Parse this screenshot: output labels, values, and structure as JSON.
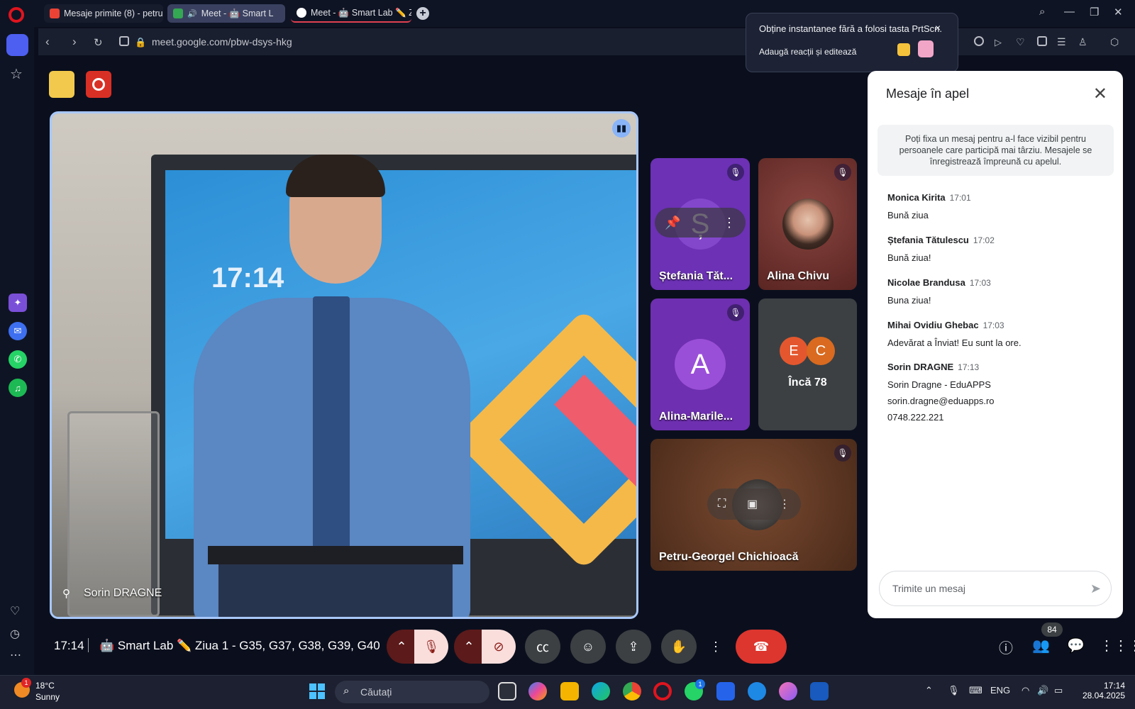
{
  "browser": {
    "tabs": [
      {
        "label": "Mesaje primite (8) - petru",
        "color": "#ea4335"
      },
      {
        "label": "Meet - 🤖 Smart L"
      },
      {
        "label": "Meet - 🤖 Smart Lab ✏️ Z"
      }
    ],
    "url": "meet.google.com/pbw-dsys-hkg"
  },
  "toast": {
    "line1": "Obține instantanee fără a folosi tasta PrtScn.",
    "line2": "Adaugă reacții și editează",
    "close": "×"
  },
  "main_tile": {
    "name": "Sorin DRAGNE",
    "screen_clock": "17:14"
  },
  "participants": [
    {
      "name": "Ștefania Tăt...",
      "initial": "Ș",
      "color": "#6c31b5"
    },
    {
      "name": "Alina Chivu",
      "color": "#6b2a26"
    },
    {
      "name": "Alina-Marile...",
      "initial": "A",
      "color": "#6e2fb0"
    },
    {
      "more_label": "Încă 78",
      "avatars": [
        {
          "letter": "E",
          "color": "#e4572e"
        },
        {
          "letter": "C",
          "color": "#e4572e"
        }
      ]
    },
    {
      "name": "Petru-Georgel Chichioacă",
      "color": "#5a3422"
    }
  ],
  "chat": {
    "title": "Mesaje în apel",
    "note": "Poți fixa un mesaj pentru a-l face vizibil pentru persoanele care participă mai târziu. Mesajele se înregistrează împreună cu apelul.",
    "messages": [
      {
        "author": "Monica Kirita",
        "time": "17:01",
        "text": "Bună ziua"
      },
      {
        "author": "Ștefania Tătulescu",
        "time": "17:02",
        "text": "Bună ziua!"
      },
      {
        "author": "Nicolae Brandusa",
        "time": "17:03",
        "text": "Buna ziua!"
      },
      {
        "author": "Mihai Ovidiu Ghebac",
        "time": "17:03",
        "text": "Adevărat a Înviat! Eu sunt la ore."
      },
      {
        "author": "Sorin DRAGNE",
        "time": "17:13",
        "lines": [
          "Sorin Dragne - EduAPPS",
          "sorin.dragne@eduapps.ro",
          "0748.222.221"
        ]
      }
    ],
    "input_placeholder": "Trimite un mesaj"
  },
  "bottom_bar": {
    "time": "17:14",
    "meeting_name": "🤖 Smart Lab ✏️ Ziua 1 - G35, G37, G38, G39, G40",
    "participants_count": "84"
  },
  "taskbar": {
    "weather_temp": "18°C",
    "weather_desc": "Sunny",
    "weather_badge": "1",
    "search_placeholder": "Căutați",
    "whatsapp_badge": "1",
    "lang": "ENG",
    "time": "17:14",
    "date": "28.04.2025"
  }
}
